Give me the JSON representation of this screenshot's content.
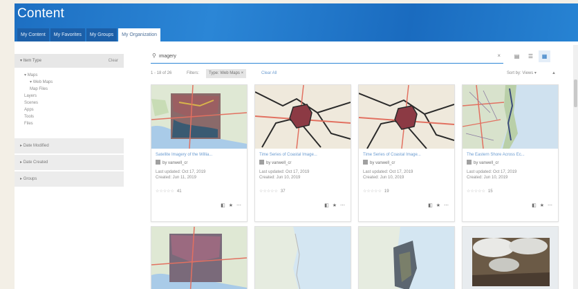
{
  "banner": {
    "title": "Content"
  },
  "tabs": [
    {
      "label": "My Content"
    },
    {
      "label": "My Favorites"
    },
    {
      "label": "My Groups"
    },
    {
      "label": "My Organization"
    }
  ],
  "sidebar": {
    "item_type": {
      "label": "Item Type",
      "clear": "Clear",
      "items": [
        {
          "label": "Maps",
          "level": 1
        },
        {
          "label": "Web Maps",
          "level": 2
        },
        {
          "label": "Map Files",
          "level": 2
        },
        {
          "label": "Layers",
          "level": 1
        },
        {
          "label": "Scenes",
          "level": 1
        },
        {
          "label": "Apps",
          "level": 1
        },
        {
          "label": "Tools",
          "level": 1
        },
        {
          "label": "Files",
          "level": 1
        }
      ]
    },
    "sections": [
      {
        "label": "Date Modified"
      },
      {
        "label": "Date Created"
      },
      {
        "label": "Groups"
      }
    ]
  },
  "search": {
    "value": "imagery",
    "clear_icon": "×"
  },
  "view": {
    "table_icon": "▤",
    "list_icon": "☰",
    "grid_icon": "▦"
  },
  "filter": {
    "count": "1 - 18 of 26",
    "label": "Filters:",
    "chip": "Type: Web Maps ×",
    "clear_all": "Clear All",
    "sort": "Sort by: Views ▾"
  },
  "cards": [
    {
      "title": "Satellite Imagery of the Willia...",
      "owner": "by vanwell_cr",
      "updated": "Last updated: Oct 17, 2019",
      "created": "Created: Jun 11, 2019",
      "rating": "☆☆☆☆☆",
      "views": "41"
    },
    {
      "title": "Time Series of Coastal Image...",
      "owner": "by vanwell_cr",
      "updated": "Last updated: Oct 17, 2019",
      "created": "Created: Jun 10, 2019",
      "rating": "☆☆☆☆☆",
      "views": "37"
    },
    {
      "title": "Time Series of Coastal Image...",
      "owner": "by vanwell_cr",
      "updated": "Last updated: Oct 17, 2019",
      "created": "Created: Jun 10, 2019",
      "rating": "☆☆☆☆☆",
      "views": "19"
    },
    {
      "title": "The Eastern Shore Across Ec...",
      "owner": "by vanwell_cr",
      "updated": "Last updated: Oct 17, 2019",
      "created": "Created: Jun 10, 2019",
      "rating": "☆☆☆☆☆",
      "views": "15"
    }
  ],
  "colors": {
    "brand": "#2b86d6",
    "link": "#6a9bd0"
  }
}
